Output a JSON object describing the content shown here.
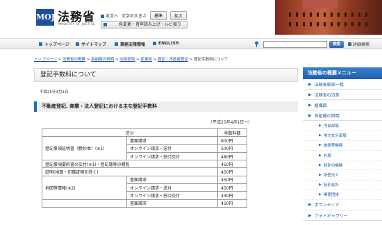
{
  "header": {
    "logo_text": "MOJ",
    "site_title": "法務省",
    "site_subtitle": "MINISTRY OF JUSTICE",
    "util_honbun": "本文へ",
    "util_fontsize_label": "文字の大きさ",
    "util_standard": "標準",
    "util_enlarge": "拡大",
    "util_bar": "色変更・音声読み上げ・ルビ振り"
  },
  "nav": {
    "items": [
      {
        "label": "トップページ"
      },
      {
        "label": "サイトマップ"
      },
      {
        "label": "業務支障情報"
      },
      {
        "label": "ENGLISH"
      }
    ],
    "search_button": "検索",
    "advanced_search": "詳細検索"
  },
  "breadcrumb": {
    "links": [
      "トップページ",
      "法務省の概要",
      "各組織の説明",
      "内部部局",
      "民事局",
      "登記・不動産登記"
    ],
    "current": "登記手数料について",
    "separator": ">"
  },
  "main": {
    "title": "登記手数料について",
    "date": "平成25年4月1日",
    "section_heading": "不動産登記, 商業・法人登記における主な登記手数料",
    "fee_note": "（平成25年4月1日～）",
    "table": {
      "header_item": "区分",
      "header_fee": "手数料額",
      "rows": [
        {
          "group": "登記事項証明書（謄抄本）(※1)",
          "method": "書面請求",
          "fee": "600円"
        },
        {
          "group": "",
          "method": "オンライン請求・送付",
          "fee": "500円"
        },
        {
          "group": "",
          "method": "オンライン請求・窓口交付",
          "fee": "480円"
        },
        {
          "group": "登記事項要約書の交付(※1)・登記簿等の閲覧",
          "method": "",
          "fee": "450円"
        },
        {
          "group": "証明(地図・印鑑証明を除く)",
          "method": "",
          "fee": "450円"
        },
        {
          "group": "地図等情報(※2)",
          "method": "書面請求",
          "fee": "450円"
        },
        {
          "group": "",
          "method": "オンライン請求・送付",
          "fee": "450円"
        },
        {
          "group": "",
          "method": "オンライン請求・窓口交付",
          "fee": "430円"
        },
        {
          "group": "",
          "method": "書面請求",
          "fee": "450円"
        }
      ]
    }
  },
  "sidebar": {
    "heading": "法務省の概要メニュー",
    "items": [
      {
        "label": "法務省幹部一覧",
        "sub": false
      },
      {
        "label": "法務省の沿革",
        "sub": false
      },
      {
        "label": "組織図",
        "sub": false
      },
      {
        "label": "各組織の説明",
        "sub": false
      },
      {
        "label": "内部部局",
        "sub": true
      },
      {
        "label": "地方支分部局",
        "sub": true
      },
      {
        "label": "施設等機関",
        "sub": true
      },
      {
        "label": "外局",
        "sub": true
      },
      {
        "label": "特別の機関",
        "sub": true
      },
      {
        "label": "所管法人",
        "sub": true
      },
      {
        "label": "特別会計",
        "sub": true
      },
      {
        "label": "関係団体",
        "sub": true
      },
      {
        "label": "ボランティア",
        "sub": false
      },
      {
        "label": "フォトギャラリー",
        "sub": false
      }
    ]
  },
  "colors": {
    "accent_blue": "#1d6fb8",
    "sidebar_head": "#2a6bbf",
    "link": "#1a55a8"
  }
}
